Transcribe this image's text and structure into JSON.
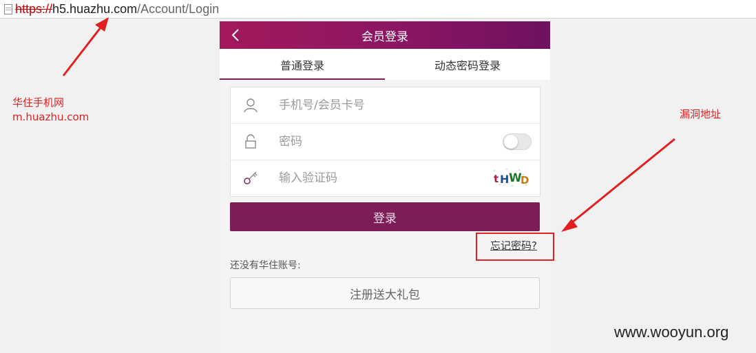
{
  "browser": {
    "url_scheme": "https://",
    "url_host": "h5.huazhu.com",
    "url_path": "/Account/Login"
  },
  "header": {
    "title": "会员登录"
  },
  "tabs": [
    {
      "label": "普通登录",
      "active": true
    },
    {
      "label": "动态密码登录",
      "active": false
    }
  ],
  "form": {
    "phone_placeholder": "手机号/会员卡号",
    "password_placeholder": "密码",
    "captcha_placeholder": "输入验证码",
    "captcha_text": "tHWD"
  },
  "actions": {
    "login_label": "登录",
    "forgot_label": "忘记密码?",
    "no_account_text": "还没有华住账号:",
    "register_label": "注册送大礼包"
  },
  "annotations": {
    "left_line1": "华住手机网",
    "left_line2": "m.huazhu.com",
    "right_note": "漏洞地址",
    "color": "#e02020"
  },
  "watermark": "www.wooyun.org",
  "colors": {
    "brand": "#7c1d56",
    "header_start": "#a3195b",
    "header_end": "#6e1160"
  }
}
